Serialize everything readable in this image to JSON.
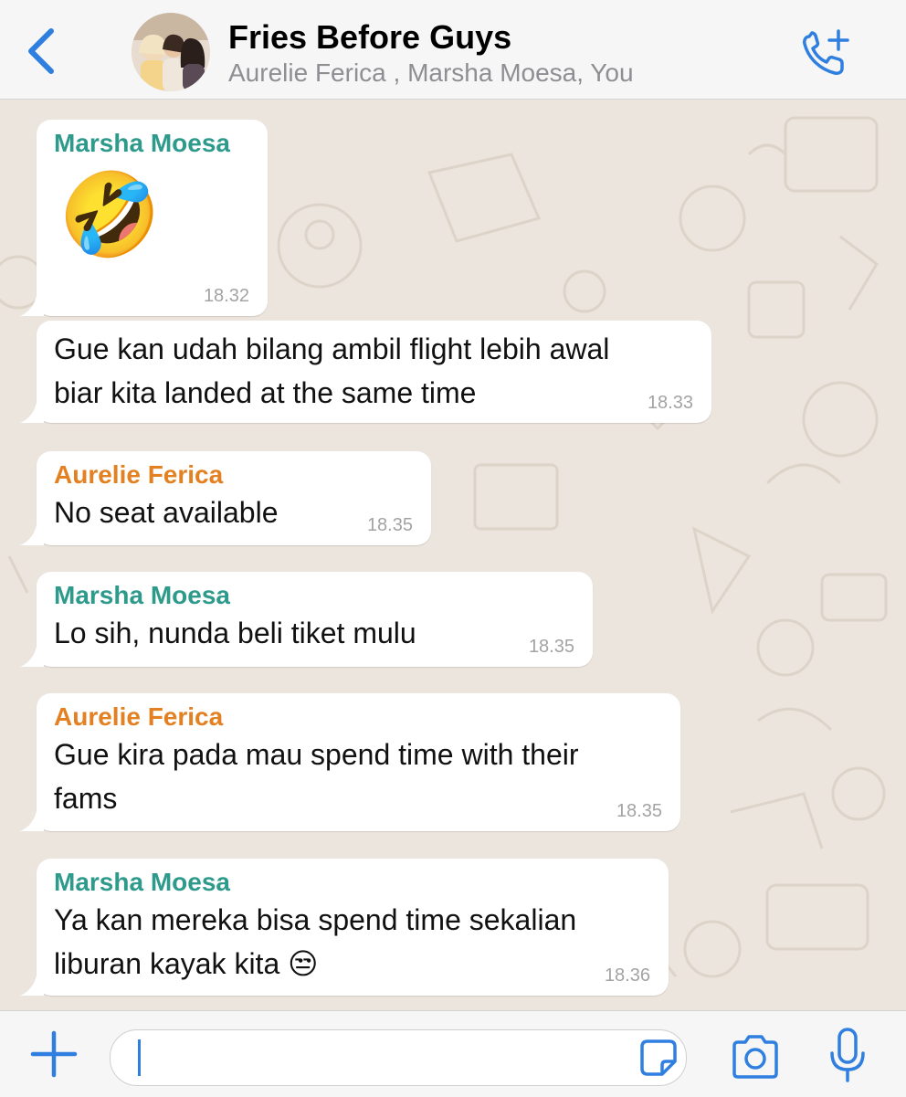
{
  "header": {
    "title": "Fries Before Guys",
    "members": "Aurelie Ferica , Marsha Moesa, You",
    "accent": "#2f7fe0"
  },
  "colors": {
    "marsha": "#2e9a8c",
    "aurelie": "#e38122"
  },
  "messages": [
    {
      "sender": "Marsha Moesa",
      "emoji": "🤣",
      "time": "18.32"
    },
    {
      "line1": "Gue kan udah bilang ambil flight lebih awal",
      "line2": "biar kita landed at the same time",
      "time": "18.33"
    },
    {
      "sender": "Aurelie Ferica",
      "line1": "No seat available",
      "time": "18.35"
    },
    {
      "sender": "Marsha Moesa",
      "line1": "Lo sih, nunda beli tiket mulu",
      "time": "18.35"
    },
    {
      "sender": "Aurelie Ferica",
      "line1": "Gue kira pada mau spend time with their",
      "line2": "fams",
      "time": "18.35"
    },
    {
      "sender": "Marsha Moesa",
      "line1": "Ya kan mereka bisa spend time sekalian",
      "line2": "liburan kayak kita 😒",
      "time": "18.36"
    }
  ],
  "composer": {
    "input_value": ""
  },
  "icons": [
    "back-chevron-icon",
    "call-add-icon",
    "plus-icon",
    "sticker-icon",
    "camera-icon",
    "microphone-icon"
  ]
}
